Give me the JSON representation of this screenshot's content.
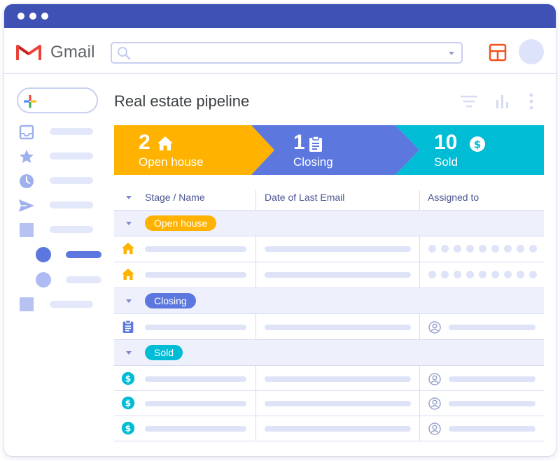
{
  "app": {
    "name": "Gmail"
  },
  "search": {
    "placeholder": ""
  },
  "page": {
    "title": "Real estate pipeline"
  },
  "pipeline": {
    "stages": [
      {
        "count": "2",
        "label": "Open house",
        "color": "#ffb300",
        "icon": "home-icon"
      },
      {
        "count": "1",
        "label": "Closing",
        "color": "#5c78df",
        "icon": "clipboard-icon"
      },
      {
        "count": "10",
        "label": "Sold",
        "color": "#00bcd4",
        "icon": "dollar-icon"
      }
    ]
  },
  "table": {
    "columns": [
      "Stage / Name",
      "Date of Last Email",
      "Assigned to"
    ],
    "groups": [
      {
        "label": "Open house",
        "color": "#ffb300",
        "icon": "home-icon",
        "rows": 2
      },
      {
        "label": "Closing",
        "color": "#5c78df",
        "icon": "clipboard-icon",
        "rows": 1
      },
      {
        "label": "Sold",
        "color": "#00bcd4",
        "icon": "dollar-icon",
        "rows": 3
      }
    ]
  },
  "colors": {
    "titlebar": "#3f51b5",
    "accent_orange": "#ffb300",
    "accent_blue": "#5c78df",
    "accent_teal": "#00bcd4",
    "sidebar_icon": "#9fb0ee"
  }
}
